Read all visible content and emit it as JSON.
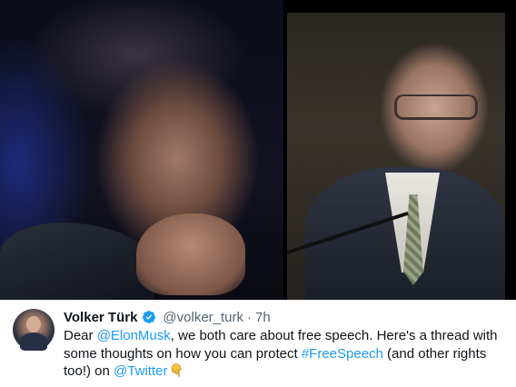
{
  "tweet": {
    "author_name": "Volker Türk",
    "handle": "@volker_turk",
    "separator": "·",
    "time": "7h",
    "text_segments": {
      "s1": "Dear ",
      "mention1": "@ElonMusk",
      "s2": ", we both care about free speech. Here's a thread with some thoughts on how you can protect ",
      "hashtag": "#FreeSpeech",
      "s3": " (and other rights too!) on ",
      "mention2": "@Twitter"
    },
    "emoji": "pointing-down-icon"
  },
  "photos": {
    "left": "photo-elon-musk",
    "right": "photo-volker-turk"
  },
  "colors": {
    "link": "#1d9bf0",
    "verified": "#1d9bf0",
    "text": "#0f1419",
    "muted": "#536471",
    "background": "#000000"
  }
}
